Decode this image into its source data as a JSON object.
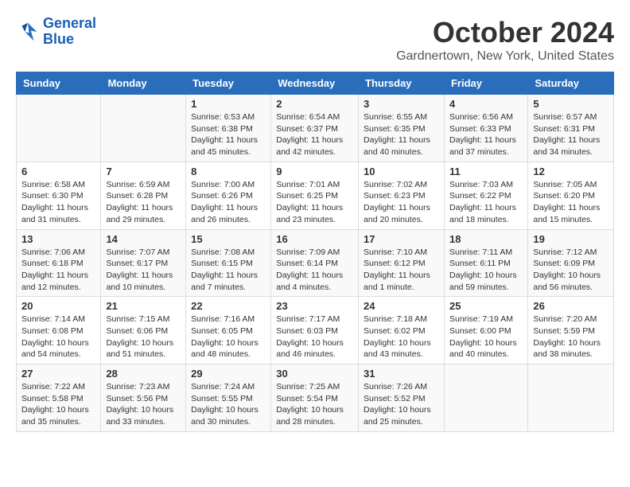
{
  "logo": {
    "line1": "General",
    "line2": "Blue"
  },
  "title": "October 2024",
  "location": "Gardnertown, New York, United States",
  "days_of_week": [
    "Sunday",
    "Monday",
    "Tuesday",
    "Wednesday",
    "Thursday",
    "Friday",
    "Saturday"
  ],
  "weeks": [
    [
      {
        "day": "",
        "info": ""
      },
      {
        "day": "",
        "info": ""
      },
      {
        "day": "1",
        "info": "Sunrise: 6:53 AM\nSunset: 6:38 PM\nDaylight: 11 hours\nand 45 minutes."
      },
      {
        "day": "2",
        "info": "Sunrise: 6:54 AM\nSunset: 6:37 PM\nDaylight: 11 hours\nand 42 minutes."
      },
      {
        "day": "3",
        "info": "Sunrise: 6:55 AM\nSunset: 6:35 PM\nDaylight: 11 hours\nand 40 minutes."
      },
      {
        "day": "4",
        "info": "Sunrise: 6:56 AM\nSunset: 6:33 PM\nDaylight: 11 hours\nand 37 minutes."
      },
      {
        "day": "5",
        "info": "Sunrise: 6:57 AM\nSunset: 6:31 PM\nDaylight: 11 hours\nand 34 minutes."
      }
    ],
    [
      {
        "day": "6",
        "info": "Sunrise: 6:58 AM\nSunset: 6:30 PM\nDaylight: 11 hours\nand 31 minutes."
      },
      {
        "day": "7",
        "info": "Sunrise: 6:59 AM\nSunset: 6:28 PM\nDaylight: 11 hours\nand 29 minutes."
      },
      {
        "day": "8",
        "info": "Sunrise: 7:00 AM\nSunset: 6:26 PM\nDaylight: 11 hours\nand 26 minutes."
      },
      {
        "day": "9",
        "info": "Sunrise: 7:01 AM\nSunset: 6:25 PM\nDaylight: 11 hours\nand 23 minutes."
      },
      {
        "day": "10",
        "info": "Sunrise: 7:02 AM\nSunset: 6:23 PM\nDaylight: 11 hours\nand 20 minutes."
      },
      {
        "day": "11",
        "info": "Sunrise: 7:03 AM\nSunset: 6:22 PM\nDaylight: 11 hours\nand 18 minutes."
      },
      {
        "day": "12",
        "info": "Sunrise: 7:05 AM\nSunset: 6:20 PM\nDaylight: 11 hours\nand 15 minutes."
      }
    ],
    [
      {
        "day": "13",
        "info": "Sunrise: 7:06 AM\nSunset: 6:18 PM\nDaylight: 11 hours\nand 12 minutes."
      },
      {
        "day": "14",
        "info": "Sunrise: 7:07 AM\nSunset: 6:17 PM\nDaylight: 11 hours\nand 10 minutes."
      },
      {
        "day": "15",
        "info": "Sunrise: 7:08 AM\nSunset: 6:15 PM\nDaylight: 11 hours\nand 7 minutes."
      },
      {
        "day": "16",
        "info": "Sunrise: 7:09 AM\nSunset: 6:14 PM\nDaylight: 11 hours\nand 4 minutes."
      },
      {
        "day": "17",
        "info": "Sunrise: 7:10 AM\nSunset: 6:12 PM\nDaylight: 11 hours\nand 1 minute."
      },
      {
        "day": "18",
        "info": "Sunrise: 7:11 AM\nSunset: 6:11 PM\nDaylight: 10 hours\nand 59 minutes."
      },
      {
        "day": "19",
        "info": "Sunrise: 7:12 AM\nSunset: 6:09 PM\nDaylight: 10 hours\nand 56 minutes."
      }
    ],
    [
      {
        "day": "20",
        "info": "Sunrise: 7:14 AM\nSunset: 6:08 PM\nDaylight: 10 hours\nand 54 minutes."
      },
      {
        "day": "21",
        "info": "Sunrise: 7:15 AM\nSunset: 6:06 PM\nDaylight: 10 hours\nand 51 minutes."
      },
      {
        "day": "22",
        "info": "Sunrise: 7:16 AM\nSunset: 6:05 PM\nDaylight: 10 hours\nand 48 minutes."
      },
      {
        "day": "23",
        "info": "Sunrise: 7:17 AM\nSunset: 6:03 PM\nDaylight: 10 hours\nand 46 minutes."
      },
      {
        "day": "24",
        "info": "Sunrise: 7:18 AM\nSunset: 6:02 PM\nDaylight: 10 hours\nand 43 minutes."
      },
      {
        "day": "25",
        "info": "Sunrise: 7:19 AM\nSunset: 6:00 PM\nDaylight: 10 hours\nand 40 minutes."
      },
      {
        "day": "26",
        "info": "Sunrise: 7:20 AM\nSunset: 5:59 PM\nDaylight: 10 hours\nand 38 minutes."
      }
    ],
    [
      {
        "day": "27",
        "info": "Sunrise: 7:22 AM\nSunset: 5:58 PM\nDaylight: 10 hours\nand 35 minutes."
      },
      {
        "day": "28",
        "info": "Sunrise: 7:23 AM\nSunset: 5:56 PM\nDaylight: 10 hours\nand 33 minutes."
      },
      {
        "day": "29",
        "info": "Sunrise: 7:24 AM\nSunset: 5:55 PM\nDaylight: 10 hours\nand 30 minutes."
      },
      {
        "day": "30",
        "info": "Sunrise: 7:25 AM\nSunset: 5:54 PM\nDaylight: 10 hours\nand 28 minutes."
      },
      {
        "day": "31",
        "info": "Sunrise: 7:26 AM\nSunset: 5:52 PM\nDaylight: 10 hours\nand 25 minutes."
      },
      {
        "day": "",
        "info": ""
      },
      {
        "day": "",
        "info": ""
      }
    ]
  ]
}
